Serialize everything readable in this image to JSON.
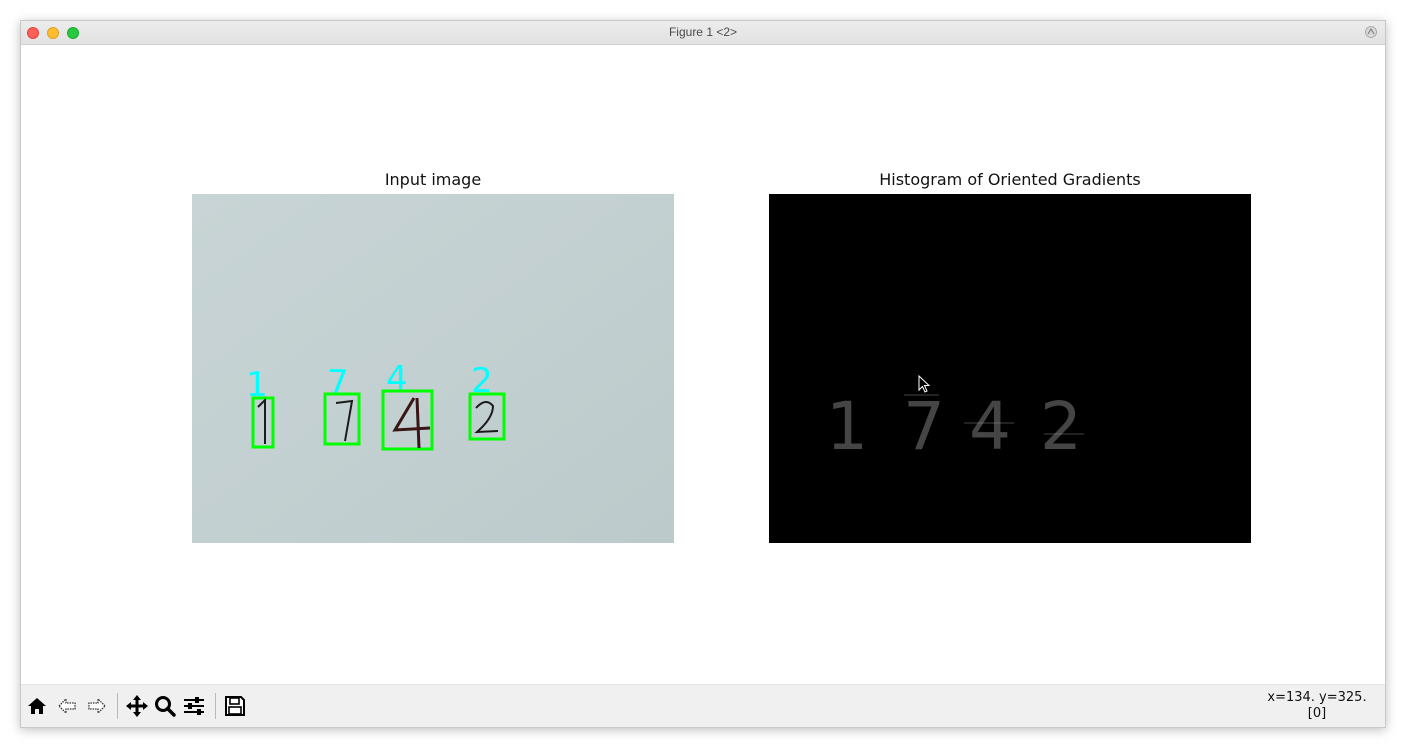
{
  "window": {
    "title": "Figure 1 <2>"
  },
  "figure": {
    "left_axes": {
      "title": "Input image",
      "detections": [
        {
          "label": "1"
        },
        {
          "label": "7"
        },
        {
          "label": "4"
        },
        {
          "label": "2"
        }
      ],
      "label_color": "#00ffff",
      "box_color": "#00ff00",
      "paper_color": "#c4d2d3"
    },
    "right_axes": {
      "title": "Histogram of Oriented Gradients",
      "background_color": "#000000",
      "hog_digits": [
        "1",
        "7",
        "4",
        "2"
      ]
    }
  },
  "toolbar": {
    "buttons": [
      {
        "name": "home-button",
        "icon": "home-icon"
      },
      {
        "name": "back-button",
        "icon": "back-arrow-icon"
      },
      {
        "name": "forward-button",
        "icon": "forward-arrow-icon"
      },
      {
        "name": "pan-button",
        "icon": "move-icon"
      },
      {
        "name": "zoom-button",
        "icon": "magnifier-icon"
      },
      {
        "name": "configure-subplots-button",
        "icon": "sliders-icon"
      },
      {
        "name": "save-button",
        "icon": "floppy-disk-icon"
      }
    ],
    "coords_line1": "x=134. y=325.",
    "coords_line2": "[0]"
  }
}
